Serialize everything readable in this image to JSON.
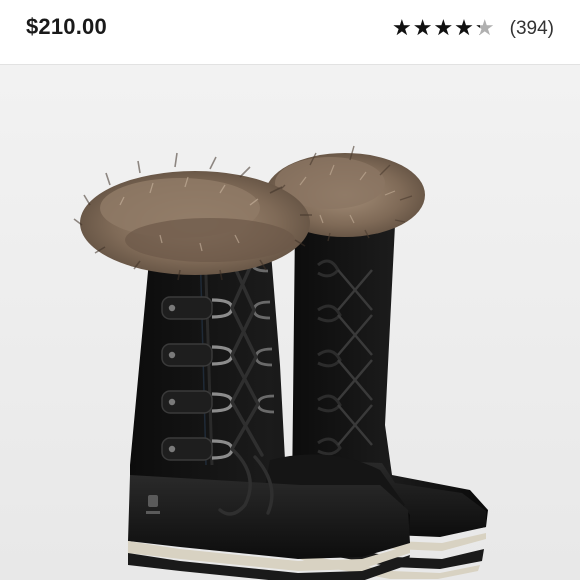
{
  "listing": {
    "price": "$210.00",
    "rating": {
      "value_fraction": 0.85,
      "stars_glyphs": "★★★★★",
      "review_count": "(394)"
    }
  },
  "product_image": {
    "subject": "boots-icon",
    "background_color": "#efefef"
  },
  "colors": {
    "star_filled": "#111111",
    "star_empty": "#b0b0b0",
    "boot_body": "#111111",
    "sole_stripe": "#d8d2c2",
    "fur": "#8a7460"
  }
}
